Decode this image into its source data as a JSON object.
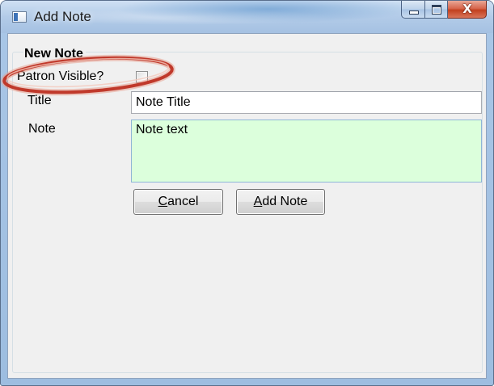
{
  "window": {
    "title": "Add Note",
    "close_glyph": "X"
  },
  "form": {
    "group_header": "New Note",
    "patron_visible_label": "Patron Visible?",
    "patron_visible_checked": false,
    "title_label": "Title",
    "title_value": "Note Title",
    "note_label": "Note",
    "note_value": "Note text",
    "note_background": "#dcffdc"
  },
  "buttons": {
    "cancel_mnemonic": "C",
    "cancel_rest": "ancel",
    "add_mnemonic": "A",
    "add_rest": "dd Note"
  },
  "annotation": {
    "ring_color": "#c0392b"
  }
}
